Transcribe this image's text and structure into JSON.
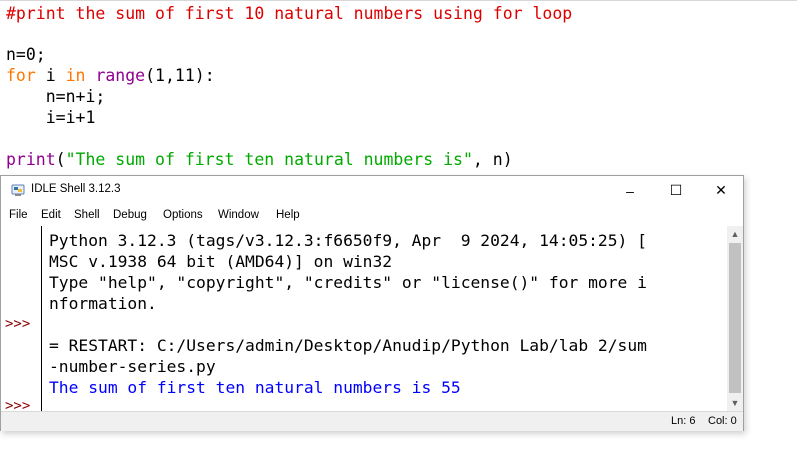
{
  "editor": {
    "comment": "#print the sum of first 10 natural numbers using for loop",
    "line_n0": "n=0;",
    "for_kw": "for",
    "for_var": " i ",
    "in_kw": "in",
    "range_fn": "range",
    "range_args": "(1,11):",
    "body1": "    n=n+i;",
    "body2": "    i=i+1",
    "print_fn": "print",
    "print_open": "(",
    "print_str": "\"The sum of first ten natural numbers is\"",
    "print_rest": ", n)"
  },
  "shell": {
    "title": "IDLE Shell 3.12.3",
    "controls": {
      "minimize": "–",
      "maximize": "☐",
      "close": "✕"
    },
    "menu": [
      "File",
      "Edit",
      "Shell",
      "Debug",
      "Options",
      "Window",
      "Help"
    ],
    "prompt": ">>>",
    "lines": [
      "Python 3.12.3 (tags/v3.12.3:f6650f9, Apr  9 2024, 14:05:25) [",
      "MSC v.1938 64 bit (AMD64)] on win32",
      "Type \"help\", \"copyright\", \"credits\" or \"license()\" for more i",
      "nformation.",
      "= RESTART: C:/Users/admin/Desktop/Anudip/Python Lab/lab 2/sum",
      "-number-series.py",
      "The sum of first ten natural numbers is 55"
    ],
    "status": {
      "line": "Ln: 6",
      "col": "Col: 0"
    }
  },
  "colors": {
    "comment": "#dd0000",
    "keyword": "#ff7700",
    "builtin": "#900090",
    "string": "#00aa00",
    "output": "#0000ff",
    "prompt": "#8b0000"
  }
}
